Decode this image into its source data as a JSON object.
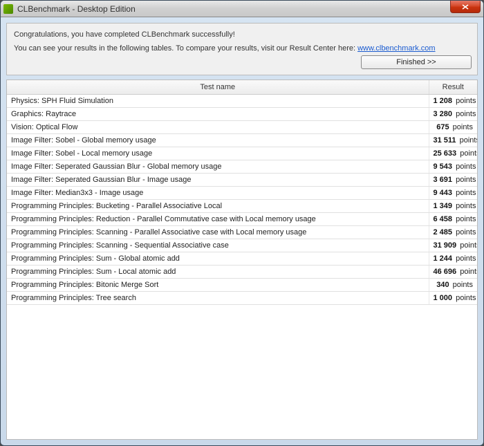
{
  "window": {
    "title": "CLBenchmark - Desktop Edition"
  },
  "info_panel": {
    "congrats": "Congratulations, you have completed CLBenchmark successfully!",
    "results_prefix": "You can see your results in the following tables. To compare your results, visit our Result Center here: ",
    "results_link_text": "www.clbenchmark.com",
    "results_link_href": "http://www.clbenchmark.com",
    "finished_label": "Finished >>"
  },
  "table": {
    "headers": {
      "name": "Test name",
      "result": "Result"
    },
    "unit": "points",
    "rows": [
      {
        "name": "Physics: SPH Fluid Simulation",
        "value": "1 208"
      },
      {
        "name": "Graphics: Raytrace",
        "value": "3 280"
      },
      {
        "name": "Vision: Optical Flow",
        "value": "675"
      },
      {
        "name": "Image Filter: Sobel - Global memory usage",
        "value": "31 511"
      },
      {
        "name": "Image Filter: Sobel - Local memory usage",
        "value": "25 633"
      },
      {
        "name": "Image Filter: Seperated Gaussian Blur - Global memory usage",
        "value": "9 543"
      },
      {
        "name": "Image Filter: Seperated Gaussian Blur - Image usage",
        "value": "3 691"
      },
      {
        "name": "Image Filter: Median3x3 - Image usage",
        "value": "9 443"
      },
      {
        "name": "Programming Principles: Bucketing - Parallel Associative Local",
        "value": "1 349"
      },
      {
        "name": "Programming Principles: Reduction - Parallel Commutative case with Local memory usage",
        "value": "6 458"
      },
      {
        "name": "Programming Principles: Scanning - Parallel Associative case with Local memory usage",
        "value": "2 485"
      },
      {
        "name": "Programming Principles: Scanning - Sequential Associative case",
        "value": "31 909"
      },
      {
        "name": "Programming Principles: Sum - Global atomic add",
        "value": "1 244"
      },
      {
        "name": "Programming Principles: Sum - Local atomic add",
        "value": "46 696"
      },
      {
        "name": "Programming Principles: Bitonic Merge Sort",
        "value": "340"
      },
      {
        "name": "Programming Principles: Tree search",
        "value": "1 000"
      }
    ]
  }
}
